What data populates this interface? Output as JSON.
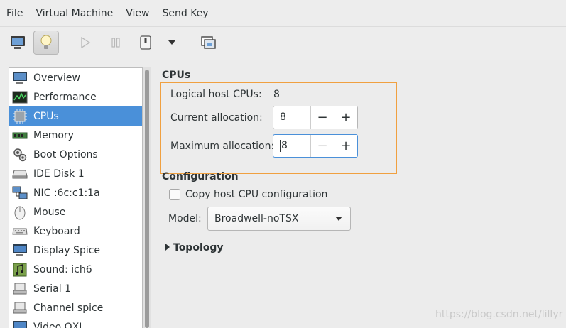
{
  "menu": [
    "File",
    "Virtual Machine",
    "View",
    "Send Key"
  ],
  "toolbar": {
    "buttons": [
      "console-icon",
      "details-icon",
      "run-icon",
      "pause-icon",
      "shutdown-icon",
      "shutdown-menu-icon",
      "fullscreen-icon"
    ]
  },
  "sidebar": {
    "items": [
      {
        "label": "Overview",
        "icon": "overview-icon"
      },
      {
        "label": "Performance",
        "icon": "performance-icon"
      },
      {
        "label": "CPUs",
        "icon": "cpu-icon",
        "selected": true
      },
      {
        "label": "Memory",
        "icon": "memory-icon"
      },
      {
        "label": "Boot Options",
        "icon": "boot-options-icon"
      },
      {
        "label": "IDE Disk 1",
        "icon": "disk-icon"
      },
      {
        "label": "NIC :6c:c1:1a",
        "icon": "nic-icon"
      },
      {
        "label": "Mouse",
        "icon": "mouse-icon"
      },
      {
        "label": "Keyboard",
        "icon": "keyboard-icon"
      },
      {
        "label": "Display Spice",
        "icon": "display-icon"
      },
      {
        "label": "Sound: ich6",
        "icon": "sound-icon"
      },
      {
        "label": "Serial 1",
        "icon": "serial-icon"
      },
      {
        "label": "Channel spice",
        "icon": "channel-icon"
      },
      {
        "label": "Video QXL",
        "icon": "video-icon"
      }
    ]
  },
  "cpus": {
    "title": "CPUs",
    "logical_label": "Logical host CPUs:",
    "logical_value": "8",
    "current_label": "Current allocation:",
    "current_value": "8",
    "maximum_label": "Maximum allocation:",
    "maximum_value": "8"
  },
  "configuration": {
    "title": "Configuration",
    "copy_host_label": "Copy host CPU configuration",
    "copy_host_checked": false,
    "model_label": "Model:",
    "model_value": "Broadwell-noTSX"
  },
  "topology": {
    "label": "Topology"
  },
  "watermark": "https://blog.csdn.net/lillyr",
  "colors": {
    "selection": "#4a90d9",
    "focus_frame": "#f0a040"
  }
}
